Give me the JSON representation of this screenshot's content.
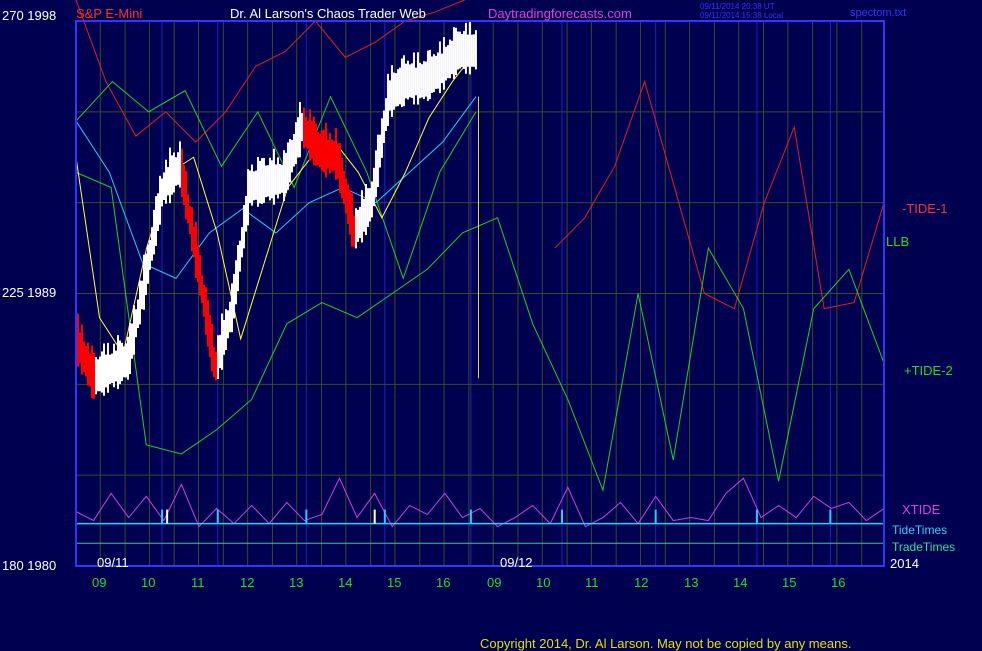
{
  "header": {
    "left_scale": "270  1998",
    "symbol": "S&P E-Mini",
    "author": "Dr. Al Larson's Chaos Trader Web",
    "site": "Daytradingforecasts.com",
    "timestamp_1": "09/11/2014 20:38 UT",
    "timestamp_2": "09/11/2014 15:38 Local",
    "file": "spectom.txt"
  },
  "left_axis": {
    "mid": "225  1989",
    "bottom": "180  1980"
  },
  "right_labels": {
    "tide1": "-TIDE-1",
    "llb": "LLB",
    "tide2": "+TIDE-2",
    "xtide": "XTIDE",
    "tidetimes": "TideTimes",
    "tradetimes": "TradeTimes",
    "year": "2014"
  },
  "date_labels": [
    "09/11",
    "09/12"
  ],
  "footer": {
    "copyright": "Copyright 2014, Dr. Al Larson. May not be copied by any means."
  },
  "colors": {
    "background": "#000050",
    "frame": "#3434ff",
    "grid": "#3a4a2a",
    "price_up": "#ffffff",
    "price_down": "#ff0000",
    "tide1": "#e02020",
    "tide2": "#20d020",
    "llb": "#20d020",
    "cyan": "#20d0ff",
    "yellow_ma": "#ffff40",
    "xtide": "#d040e0",
    "tradetimes": "#20d0a0"
  },
  "chart_data": {
    "type": "line",
    "title": "S&P E-Mini",
    "xlabel": "",
    "ylabel": "",
    "ylim": [
      1980,
      1998
    ],
    "y_tick_labels": [
      "270  1998",
      "225  1989",
      "180  1980"
    ],
    "x_tick_labels": [
      "09",
      "10",
      "11",
      "12",
      "13",
      "14",
      "15",
      "16",
      "09",
      "10",
      "11",
      "12",
      "13",
      "14",
      "15",
      "16"
    ],
    "x_date_labels": [
      "09/11",
      "09/12"
    ],
    "series": [
      {
        "name": "S&P E-Mini",
        "x_range": [
          0,
          7.9
        ],
        "y": [
          1987.5,
          1986.2,
          1986.5,
          1986.8,
          1989.5,
          1992.5,
          1993.2,
          1990.0,
          1986.5,
          1988.5,
          1992.5,
          1992.7,
          1992.8,
          1994.5,
          1993.7,
          1993.5,
          1991.0,
          1992.0,
          1995.5,
          1996.0,
          1996.0,
          1996.4,
          1997.0,
          1997.0
        ]
      },
      {
        "name": "-TIDE-1",
        "x_range": [
          0,
          15.96
        ],
        "y": [
          1998.7,
          1996.0,
          1994.2,
          1995.0,
          1994.0,
          1995.0,
          1996.5,
          1997.0,
          1998.0,
          1996.8,
          1997.3,
          1998.0,
          1998.3,
          1998.7,
          1999.0,
          1999.5,
          1990.5,
          1991.5,
          1993.2,
          1996.0,
          1992.5,
          1989.0,
          1988.5,
          1992.0,
          1994.5,
          1988.5,
          1988.7,
          1992.0
        ],
        "y_segment_2_start_index": 16
      },
      {
        "name": "+TIDE-2",
        "x_range": [
          0,
          15.96
        ],
        "y": [
          1993.0,
          1992.5,
          1984.0,
          1983.7,
          1984.5,
          1985.5,
          1988.0,
          1988.7,
          1988.2,
          1989.0,
          1989.8,
          1991.0,
          1991.5,
          1988.0,
          1985.5,
          1982.5,
          1989.0,
          1983.5,
          1990.5,
          1988.5,
          1982.8,
          1988.5,
          1989.8,
          1986.7
        ]
      },
      {
        "name": "LLB",
        "x_range": [
          0,
          7.9
        ],
        "y": [
          1994.7,
          1996.0,
          1995.0,
          1995.7,
          1993.2,
          1995.0,
          1992.5,
          1995.5,
          1993.0,
          1989.5,
          1993.0,
          1995.0
        ]
      },
      {
        "name": "",
        "x_range": [
          0,
          7.9
        ],
        "y": [
          1994.7,
          1993.0,
          1990.0,
          1989.5,
          1991.0,
          1991.8,
          1991.0,
          1992.0,
          1992.5,
          1992.0,
          1993.0,
          1994.0,
          1995.5
        ]
      },
      {
        "name": "",
        "x_range": [
          0,
          7.9
        ],
        "y": [
          1993.5,
          1988.2,
          1987.0,
          1990.5,
          1993.0,
          1993.5,
          1991.0,
          1987.5,
          1990.0,
          1992.5,
          1993.5,
          1994.0,
          1993.0,
          1991.5,
          1993.0,
          1994.8,
          1996.0,
          1997.0
        ]
      },
      {
        "name": "XTIDE",
        "x_range": [
          0,
          15.96
        ],
        "y": [
          1981.8,
          1981.5,
          1982.4,
          1981.6,
          1982.3,
          1981.5,
          1982.7,
          1981.3,
          1981.9,
          1981.4,
          1982.0,
          1981.4,
          1982.1,
          1981.5,
          1981.7,
          1982.9,
          1981.6,
          1982.4,
          1981.3,
          1982.0,
          1981.7,
          1982.4,
          1981.6,
          1981.9,
          1981.3,
          1981.6,
          1982.0,
          1981.4,
          1982.6,
          1981.3,
          1981.6,
          1982.1,
          1981.4,
          1982.3,
          1981.5,
          1981.6,
          1981.5,
          1982.4,
          1982.9,
          1981.6,
          1982.0,
          1981.6,
          1982.3,
          1981.9,
          1982.1,
          1981.5,
          1981.9
        ]
      },
      {
        "name": "TideTimes",
        "y": 1981.4
      },
      {
        "name": "TradeTimes",
        "y": 1980.75
      }
    ],
    "tide_time_marks_x": [
      1.7,
      2.8,
      4.55,
      6.1,
      7.8,
      9.6,
      11.45,
      13.45,
      14.9
    ],
    "tide_time_marks_x_white": [
      1.8,
      5.9
    ]
  }
}
